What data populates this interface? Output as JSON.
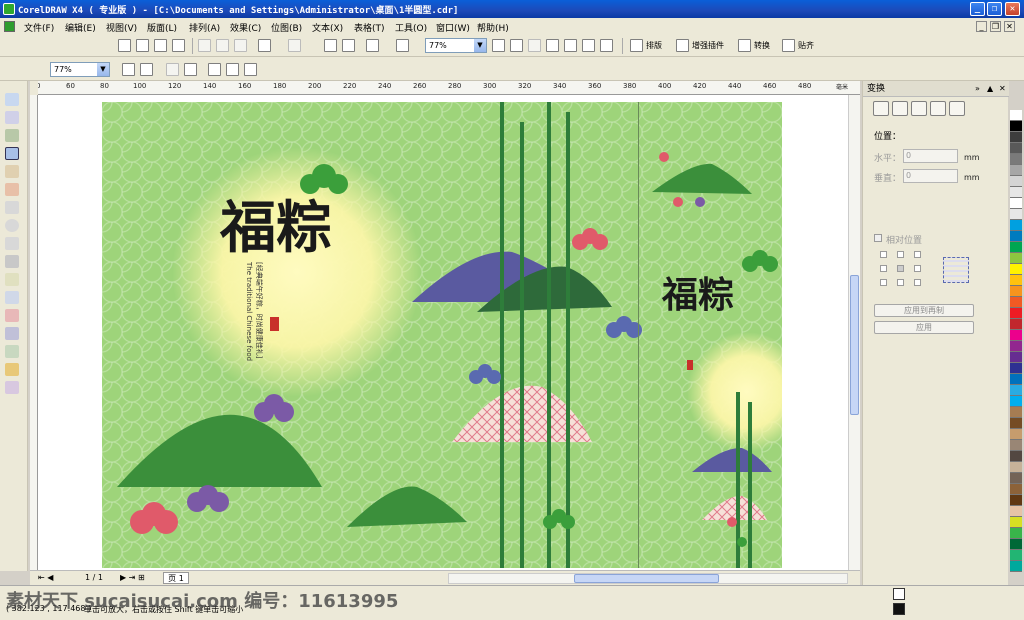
{
  "window": {
    "title": "CorelDRAW X4 ( 专业版 ) - [C:\\Documents and Settings\\Administrator\\桌面\\1半圆型.cdr]",
    "buttons": [
      "_",
      "❐",
      "✕"
    ]
  },
  "menu": {
    "items": [
      "文件(F)",
      "编辑(E)",
      "视图(V)",
      "版面(L)",
      "排列(A)",
      "效果(C)",
      "位图(B)",
      "文本(X)",
      "表格(T)",
      "工具(O)",
      "窗口(W)",
      "帮助(H)"
    ],
    "mdi_buttons": [
      "_",
      "❐",
      "✕"
    ]
  },
  "toolbar": {
    "zoom_value": "77%",
    "plugin_labels": [
      "排版",
      "增强插件",
      "转换",
      "贴齐"
    ]
  },
  "property_bar": {
    "zoom_value": "77%"
  },
  "ruler": {
    "h_labels": [
      "0",
      "60",
      "80",
      "100",
      "120",
      "140",
      "160",
      "180",
      "200",
      "220",
      "240",
      "260",
      "280",
      "300",
      "320",
      "340",
      "360",
      "380",
      "400",
      "420",
      "440",
      "460",
      "480"
    ],
    "unit_label": "毫米"
  },
  "artwork": {
    "main_title": "福粽",
    "sub_title": "福粽",
    "tagline_cn": "[经典端午好粽，时尚健康佳礼]",
    "tagline_en": "The traditional Chinese food",
    "colors": {
      "background": "#9ed47a",
      "glow": "#fff9b0",
      "hill": "#3b8f3b",
      "bamboo": "#2e7d3a",
      "cloud_red": "#e05a6a",
      "cloud_purple": "#7b5aa6",
      "cloud_blue": "#5a6ab0"
    }
  },
  "page_nav": {
    "page_counter": "1 / 1",
    "page_tab": "页 1"
  },
  "docker": {
    "title": "变换",
    "controls": [
      "»",
      "▲",
      "✕"
    ],
    "section_label": "位置：",
    "horizontal_label": "水平：",
    "horizontal_value": "0",
    "vertical_label": "垂直：",
    "vertical_value": "0",
    "unit": "mm",
    "relative_label": "相对位置",
    "apply_copy_button": "应用到再制",
    "apply_button": "应用"
  },
  "palette": {
    "colors": [
      "#ffffff",
      "#000000",
      "#3d3d3d",
      "#595959",
      "#7a7a7a",
      "#a6a6a6",
      "#d4d4d4",
      "#e6e6e6",
      "#ffffff",
      "#e6e6e6",
      "#00a0e0",
      "#007bbf",
      "#00a651",
      "#8dc63f",
      "#fff200",
      "#ffc20e",
      "#f7941d",
      "#f15a24",
      "#ed1c24",
      "#c1272d",
      "#ec008c",
      "#92278f",
      "#662d91",
      "#2e3192",
      "#0071bc",
      "#29abe2",
      "#00aeef",
      "#a67c52",
      "#754c24",
      "#c69c6d",
      "#998675",
      "#534741",
      "#c7b299",
      "#736357",
      "#8c6239",
      "#603813",
      "#e6c3a6",
      "#d7df23",
      "#39b54a",
      "#006837",
      "#22b573",
      "#00a99d"
    ]
  },
  "status": {
    "coords": "( 382.123 , 117.468 )",
    "hint": "单击可放大，右击或按住 Shift 键单击可缩小",
    "watermark": "素材天下 sucaisucai.com   编号：11613995"
  }
}
